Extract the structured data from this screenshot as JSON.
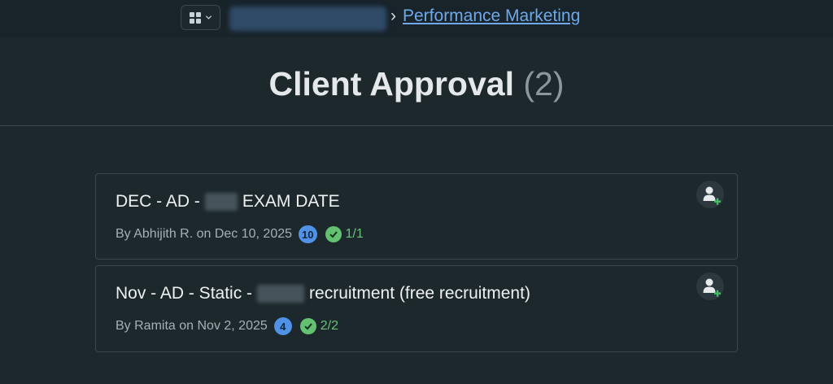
{
  "breadcrumb": {
    "separator": "›",
    "current_label": "Performance Marketing"
  },
  "page": {
    "title": "Client Approval",
    "count": "(2)"
  },
  "colors": {
    "background": "#1d282c",
    "link": "#6fa9ea",
    "count_badge": "#4f92e6",
    "approved": "#63c171"
  },
  "icons": {
    "app_switcher": "grid-icon",
    "switcher_caret": "chevron-down-icon",
    "assign": "user-add-icon",
    "approved": "check-circle-icon"
  },
  "cards": [
    {
      "title_start": "DEC - AD -",
      "title_end": "EXAM DATE",
      "author_text": "By Abhijith R. on Dec 10, 2025",
      "count": "10",
      "approvals": "1/1"
    },
    {
      "title_start": "Nov - AD - Static -",
      "title_end": "recruitment (free recruitment)",
      "author_text": "By Ramita on Nov 2, 2025",
      "count": "4",
      "approvals": "2/2"
    }
  ]
}
